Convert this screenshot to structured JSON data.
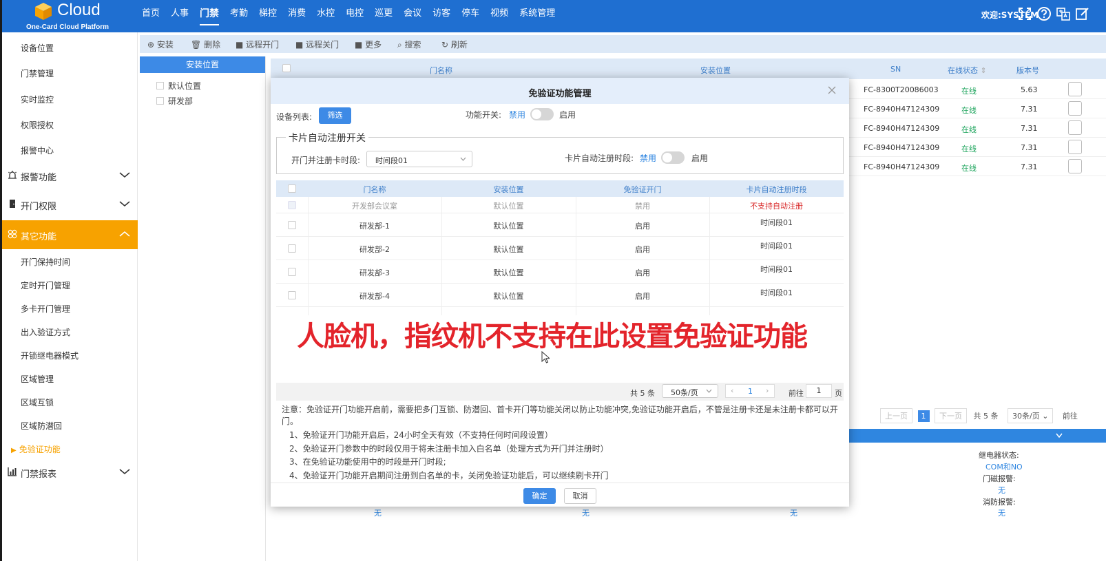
{
  "header": {
    "brand": "Cloud",
    "sub_brand": "One-Card Cloud Platform",
    "nav": [
      "首页",
      "人事",
      "门禁",
      "考勤",
      "梯控",
      "消费",
      "水控",
      "电控",
      "巡更",
      "会议",
      "访客",
      "停车",
      "视频",
      "系统管理"
    ],
    "active_nav": "门禁",
    "welcome": "欢迎:SYSTEM"
  },
  "sidebar": {
    "top_items": [
      "设备位置",
      "门禁管理",
      "实时监控",
      "权限授权",
      "报警中心"
    ],
    "groups": [
      {
        "label": "报警功能",
        "icon": "alarm-icon"
      },
      {
        "label": "开门权限",
        "icon": "door-icon"
      },
      {
        "label": "其它功能",
        "icon": "apps-icon"
      }
    ],
    "other_items": [
      "开门保持时间",
      "定时开门管理",
      "多卡开门管理",
      "出入验证方式",
      "开锁继电器模式",
      "区域管理",
      "区域互锁",
      "区域防潜回"
    ],
    "active_item": "免验证功能",
    "last_group": {
      "label": "门禁报表",
      "icon": "report-icon"
    }
  },
  "toolbar": {
    "install": "安装",
    "delete": "删除",
    "remote_open": "远程开门",
    "remote_close": "远程关门",
    "more": "更多",
    "search": "搜索",
    "refresh": "刷新"
  },
  "tree": {
    "header": "安装位置",
    "items": [
      "默认位置",
      "研发部"
    ]
  },
  "bg_table": {
    "columns": {
      "door": "门名称",
      "location": "安装位置",
      "sn": "SN",
      "status": "在线状态",
      "version": "版本号"
    },
    "rows": [
      {
        "sn": "FC-8300T20086003",
        "status": "在线",
        "version": "5.63"
      },
      {
        "sn": "FC-8940H47124309",
        "status": "在线",
        "version": "7.31"
      },
      {
        "sn": "FC-8940H47124309",
        "status": "在线",
        "version": "7.31"
      },
      {
        "sn": "FC-8940H47124309",
        "status": "在线",
        "version": "7.31"
      },
      {
        "sn": "FC-8940H47124309",
        "status": "在线",
        "version": "7.31"
      }
    ],
    "pager": {
      "prev": "上一页",
      "page": "1",
      "next": "下一页",
      "total": "共 5 条",
      "size": "30条/页",
      "goto": "前往"
    },
    "info": {
      "relay_label": "继电器状态:",
      "relay_value": "COM和NO",
      "door_alarm_label": "门磁报警:",
      "door_alarm_value": "无",
      "fire_alarm_label": "消防报警:",
      "fire_alarm_value": "无",
      "none": "无"
    }
  },
  "modal": {
    "title": "免验证功能管理",
    "device_list_label": "设备列表:",
    "filter_button": "筛选",
    "func_switch_label": "功能开关:",
    "off": "禁用",
    "on": "启用",
    "legend": "卡片自动注册开关",
    "open_register_label": "开门并注册卡时段:",
    "open_register_value": "时间段01",
    "auto_register_label": "卡片自动注册时段:",
    "table": {
      "columns": [
        "门名称",
        "安装位置",
        "免验证开门",
        "卡片自动注册时段"
      ],
      "rows": [
        {
          "name": "开发部会议室",
          "location": "默认位置",
          "free": "禁用",
          "period": "不支持自动注册",
          "disabled": true
        },
        {
          "name": "研发部-1",
          "location": "默认位置",
          "free": "启用",
          "period": "时间段01"
        },
        {
          "name": "研发部-2",
          "location": "默认位置",
          "free": "启用",
          "period": "时间段01"
        },
        {
          "name": "研发部-3",
          "location": "默认位置",
          "free": "启用",
          "period": "时间段01"
        },
        {
          "name": "研发部-4",
          "location": "默认位置",
          "free": "启用",
          "period": "时间段01"
        }
      ]
    },
    "pager": {
      "total": "共 5 条",
      "size": "50条/页",
      "page": "1",
      "goto": "前往",
      "goto_value": "1",
      "page_unit": "页"
    },
    "notes": {
      "intro": "注意：免验证开门功能开启前，需要把多门互锁、防潜回、首卡开门等功能关闭以防止功能冲突,免验证功能开启后，不管是注册卡还是未注册卡都可以开",
      "intro_cont": "门。",
      "items": [
        "1、免验证开门功能开启后，24小时全天有效（不支持任何时间段设置）",
        "2、免验证开门参数中的时段仅用于将未注册卡加入白名单（处理方式为开门并注册时）",
        "3、在免验证功能使用中的时段是开门时段;",
        "4、免验证开门功能开启期间注册到白名单的卡，关闭免验证功能后，可以继续刷卡开门"
      ]
    },
    "ok": "确定",
    "cancel": "取消"
  },
  "subtitle": "人脸机，指纹机不支持在此设置免验证功能"
}
